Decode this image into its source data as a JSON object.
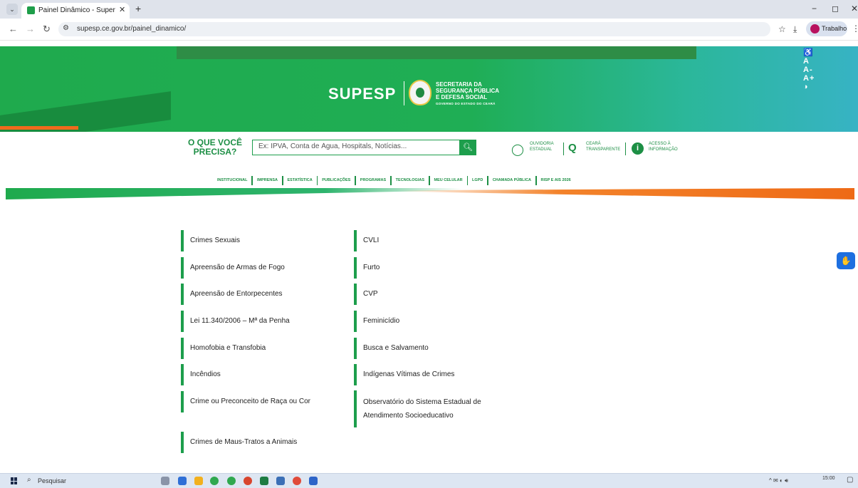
{
  "browser": {
    "tab_title": "Painel Dinâmico - Superintendê",
    "tab_close": "✕",
    "new_tab": "+",
    "url": "supesp.ce.gov.br/painel_dinamico/",
    "profile_label": "Trabalho",
    "win_min": "−",
    "win_max": "◻",
    "win_close": "✕"
  },
  "header": {
    "accessibility": "♿ A A- A+ ◑",
    "logo_text": "SUPESP",
    "logo_lines": [
      "SECRETARIA DA",
      "SEGURANÇA PÚBLICA",
      "E DEFESA SOCIAL"
    ],
    "logo_gov": "GOVERNO DO ESTADO DO CEARÁ"
  },
  "search": {
    "prompt": "O QUE VOCÊ PRECISA?",
    "placeholder": "Ex: IPVA, Conta de Água, Hospitals, Notícias..."
  },
  "services": [
    {
      "label": "OUVIDORIA\nESTADUAL",
      "icon": "speech-bubble-icon"
    },
    {
      "label": "CEARÁ\nTRANSPARENTE",
      "icon": "search-icon"
    },
    {
      "label": "ACESSO À\nINFORMAÇÃO",
      "icon": "info-icon"
    }
  ],
  "nav": [
    "INSTITUCIONAL",
    "IMPRENSA",
    "ESTATÍSTICA",
    "PUBLICAÇÕES",
    "PROGRAMAS",
    "TECNOLOGIAS",
    "MEU CELULAR",
    "LGPD",
    "CHAMADA PÚBLICA",
    "RISP E AIS 2026"
  ],
  "left_items": [
    "Crimes Sexuais",
    "Apreensão de Armas de Fogo",
    "Apreensão de Entorpecentes",
    "Lei 11.340/2006 – Mª da Penha",
    "Homofobia e Transfobia",
    "Incêndios",
    "Crime ou Preconceito de Raça ou Cor",
    "Crimes de Maus-Tratos a Animais"
  ],
  "right_items": [
    "CVLI",
    "Furto",
    "CVP",
    "Feminicídio",
    "Busca e Salvamento",
    "Indígenas Vítimas de Crimes",
    "Observatório do Sistema Estadual de Atendimento Socioeducativo"
  ],
  "taskbar": {
    "search_label": "Pesquisar",
    "clock": "15:00"
  },
  "colors": {
    "brand_green": "#1d9e4c",
    "accent_orange": "#f06a1c"
  }
}
